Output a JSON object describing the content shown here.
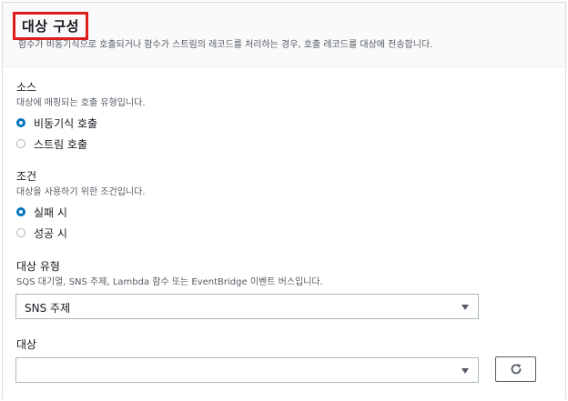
{
  "header": {
    "title": "대상 구성",
    "description": "함수가 비동기식으로 호출되거나 함수가 스트림의 레코드를 처리하는 경우, 호출 레코드를 대상에 전송합니다."
  },
  "source": {
    "label": "소스",
    "description": "대상에 매핑되는 호출 유형입니다.",
    "options": [
      {
        "label": "비동기식 호출",
        "checked": true
      },
      {
        "label": "스트림 호출",
        "checked": false
      }
    ]
  },
  "condition": {
    "label": "조건",
    "description": "대상을 사용하기 위한 조건입니다.",
    "options": [
      {
        "label": "실패 시",
        "checked": true
      },
      {
        "label": "성공 시",
        "checked": false
      }
    ]
  },
  "destination_type": {
    "label": "대상 유형",
    "description": "SQS 대기열, SNS 주제, Lambda 함수 또는 EventBridge 이벤트 버스입니다.",
    "selected": "SNS 주제"
  },
  "destination": {
    "label": "대상",
    "selected": ""
  },
  "colors": {
    "accent": "#0073bb",
    "highlight_border": "#e01d1d"
  },
  "icons": {
    "caret": "caret-down-icon",
    "refresh": "refresh-icon"
  }
}
